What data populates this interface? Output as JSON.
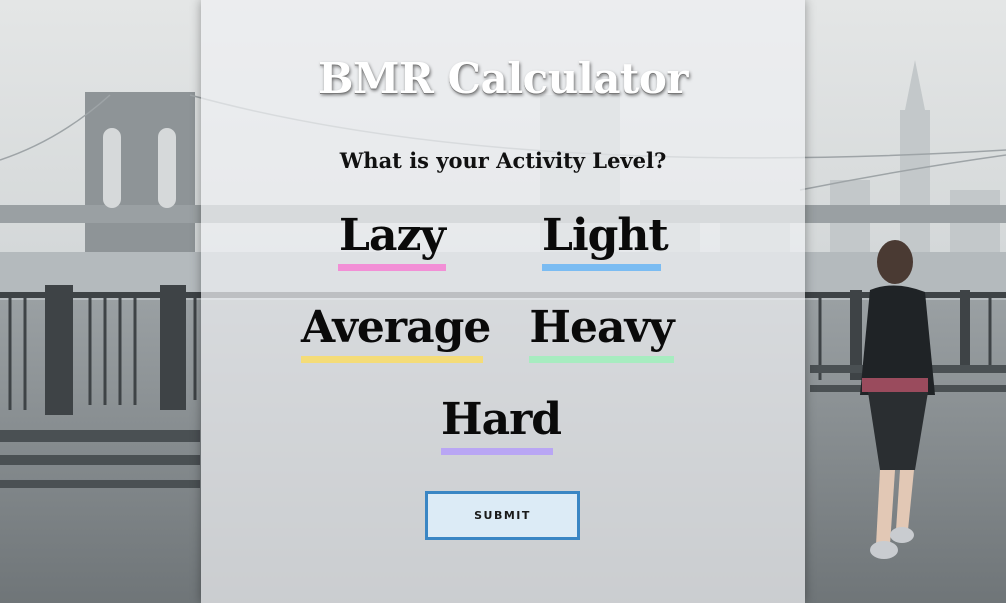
{
  "page": {
    "title": "BMR Calculator",
    "question": "What is your Activity Level?"
  },
  "options": [
    {
      "label": "Lazy",
      "underline_color": "#f28fd6"
    },
    {
      "label": "Light",
      "underline_color": "#7bbcf2"
    },
    {
      "label": "Average",
      "underline_color": "#f4dc78"
    },
    {
      "label": "Heavy",
      "underline_color": "#a7ecc0"
    },
    {
      "label": "Hard",
      "underline_color": "#b9a6f4"
    }
  ],
  "submit": {
    "label": "SUBMIT",
    "border_color": "#3a86c4",
    "fill_color": "#dcebf6"
  },
  "background": {
    "scene": "rainy waterfront promenade with bridge and runner",
    "sky_color": "#d9dcdd",
    "water_color": "#c4c9cb",
    "structure_color": "#5b6063"
  }
}
